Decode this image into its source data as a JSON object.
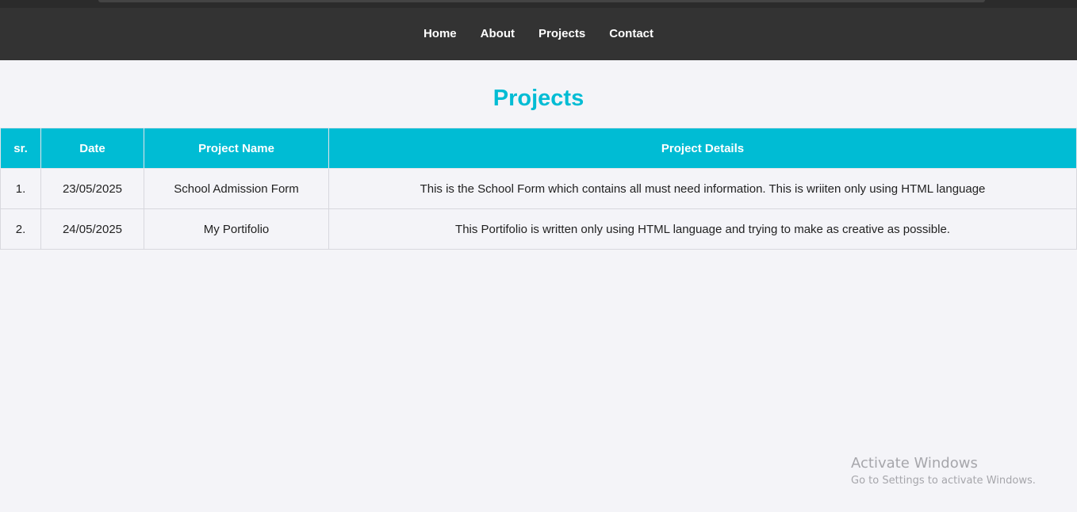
{
  "nav": {
    "items": [
      {
        "label": "Home"
      },
      {
        "label": "About"
      },
      {
        "label": "Projects"
      },
      {
        "label": "Contact"
      }
    ]
  },
  "page": {
    "title": "Projects"
  },
  "table": {
    "headers": [
      "sr.",
      "Date",
      "Project Name",
      "Project Details"
    ],
    "rows": [
      {
        "sr": "1.",
        "date": "23/05/2025",
        "name": "School Admission Form",
        "details": "This is the School Form which contains all must need information. This is wriiten only using HTML language"
      },
      {
        "sr": "2.",
        "date": "24/05/2025",
        "name": "My Portifolio",
        "details": "This Portifolio is written only using HTML language and trying to make as creative as possible."
      }
    ]
  },
  "watermark": {
    "title": "Activate Windows",
    "subtitle": "Go to Settings to activate Windows."
  },
  "colors": {
    "accent": "#00bcd4",
    "navbar": "#333333",
    "background": "#f4f4f8"
  }
}
